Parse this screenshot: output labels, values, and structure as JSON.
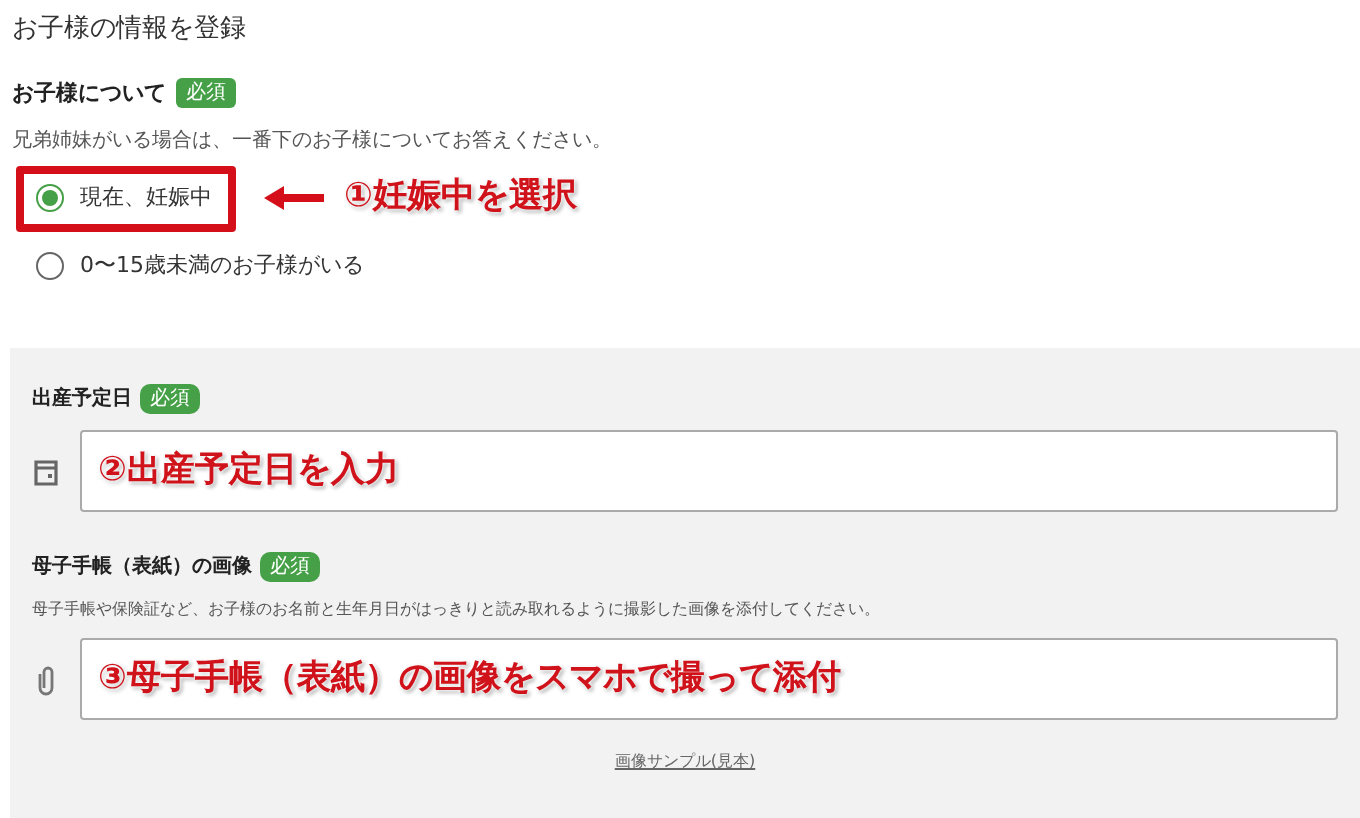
{
  "heading": "お子様の情報を登録",
  "child_section": {
    "label": "お子様について",
    "badge": "必須",
    "hint": "兄弟姉妹がいる場合は、一番下のお子様についてお答えください。",
    "options": [
      {
        "label": "現在、妊娠中",
        "selected": true,
        "highlighted": true,
        "annotation": "①妊娠中を選択"
      },
      {
        "label": "0〜15歳未満のお子様がいる",
        "selected": false,
        "highlighted": false
      }
    ]
  },
  "fields": [
    {
      "kind": "date",
      "label": "出産予定日",
      "badge": "必須",
      "annotation": "②出産予定日を入力"
    },
    {
      "kind": "file",
      "label": "母子手帳（表紙）の画像",
      "badge": "必須",
      "hint": "母子手帳や保険証など、お子様のお名前と生年月日がはっきりと読み取れるように撮影した画像を添付してください。",
      "annotation": "③母子手帳（表紙）の画像をスマホで撮って添付",
      "link": "画像サンプル(見本)"
    }
  ]
}
